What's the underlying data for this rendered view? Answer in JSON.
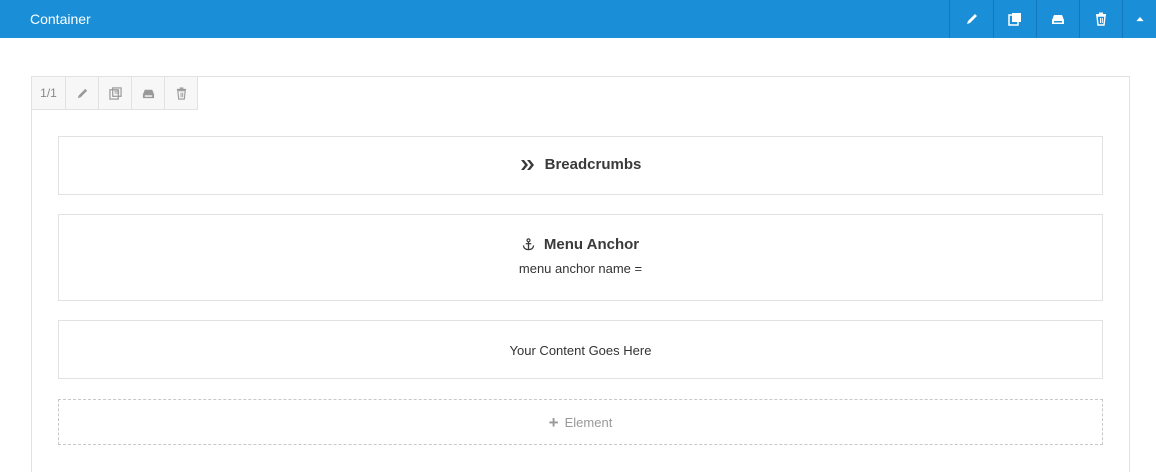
{
  "header": {
    "title": "Container",
    "actions": [
      {
        "name": "edit-icon"
      },
      {
        "name": "clone-icon"
      },
      {
        "name": "save-icon"
      },
      {
        "name": "delete-icon"
      },
      {
        "name": "collapse-icon"
      }
    ]
  },
  "column": {
    "size_label": "1/1",
    "tools": [
      "edit-icon",
      "clone-icon",
      "save-icon",
      "delete-icon"
    ]
  },
  "elements": {
    "breadcrumbs": {
      "icon": "double-chevron-icon",
      "title": "Breadcrumbs"
    },
    "menu_anchor": {
      "icon": "anchor-icon",
      "title": "Menu Anchor",
      "subtitle": "menu anchor name ="
    },
    "content": {
      "text": "Your Content Goes Here"
    },
    "add_element": {
      "icon": "plus-icon",
      "label": "Element"
    }
  },
  "colors": {
    "header_bg": "#1a8fd8",
    "border": "#e2e2e2",
    "muted_text": "#999999"
  }
}
